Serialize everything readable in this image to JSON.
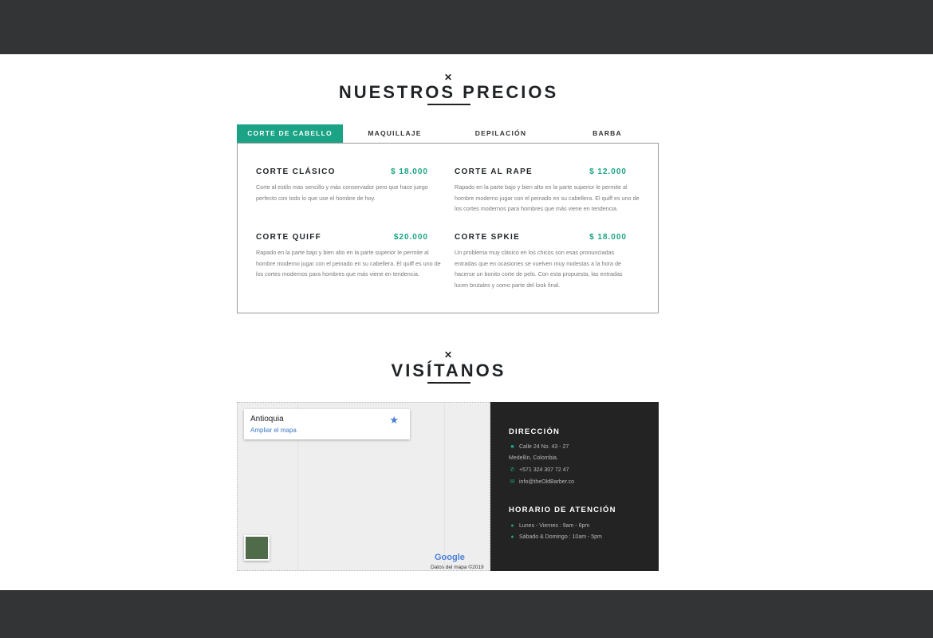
{
  "pricing": {
    "mark": "✕",
    "title": "NUESTROS PRECIOS",
    "tabs": [
      {
        "label": "CORTE DE CABELLO"
      },
      {
        "label": "MAQUILLAJE"
      },
      {
        "label": "DEPILACIÓN"
      },
      {
        "label": "BARBA"
      }
    ],
    "items": [
      {
        "name": "CORTE CLÁSICO",
        "price": "$ 18.000",
        "description": "Corte al estilo mas sencillo y más conservador pero que hace juego perfecto con todo lo que use el hombre de hoy."
      },
      {
        "name": "CORTE AL RAPE",
        "price": "$ 12.000",
        "description": "Rapado en la parte bajo y bien alto en la parte superior le permite al hombre moderno jugar con el peinado en su cabellera. El quiff es uno de los cortes modernos para hombres que más viene en tendencia."
      },
      {
        "name": "CORTE QUIFF",
        "price": "$20.000",
        "description": "Rapado en la parte bajo y bien alto en la parte superior le permite al hombre moderno jugar con el peinado en su cabellera. El quiff es uno de los cortes modernos para hombres que más viene en tendencia."
      },
      {
        "name": "CORTE SPKIE",
        "price": "$ 18.000",
        "description": "Un problema muy clásico en los chicos son esas pronunciadas entradas que en ocasiones se vuelven muy molestas a la hora de hacerse un bonito corte de pelo. Con esta propuesta, las entradas lucen brutales y como parte del look final."
      }
    ]
  },
  "visit": {
    "mark": "✕",
    "title": "VISÍTANOS",
    "map": {
      "place": "Antioquia",
      "link": "Ampliar el mapa",
      "google": "Google",
      "credit": "Datos del mapa ©2019"
    },
    "contact": {
      "address_heading": "DIRECCIÓN",
      "address_line1": "Calle 24 No. 43 - 27",
      "address_line2": "Medellín, Colombia.",
      "phone": "+571 324 307 72 47",
      "email": "info@theOldBarber.co",
      "hours_heading": "HORARIO DE ATENCIÓN",
      "hours_weekdays": "Lunes - Viernes : 9am - 6pm",
      "hours_weekend": "Sábado & Domingo : 10am - 5pm"
    }
  },
  "colors": {
    "accent": "#1aa384",
    "dark_panel": "#232323",
    "chrome": "#333436"
  },
  "icons": {
    "address": "map-icon",
    "phone": "phone-icon",
    "email": "envelope-icon",
    "clock": "clock-icon",
    "star": "star-icon"
  }
}
